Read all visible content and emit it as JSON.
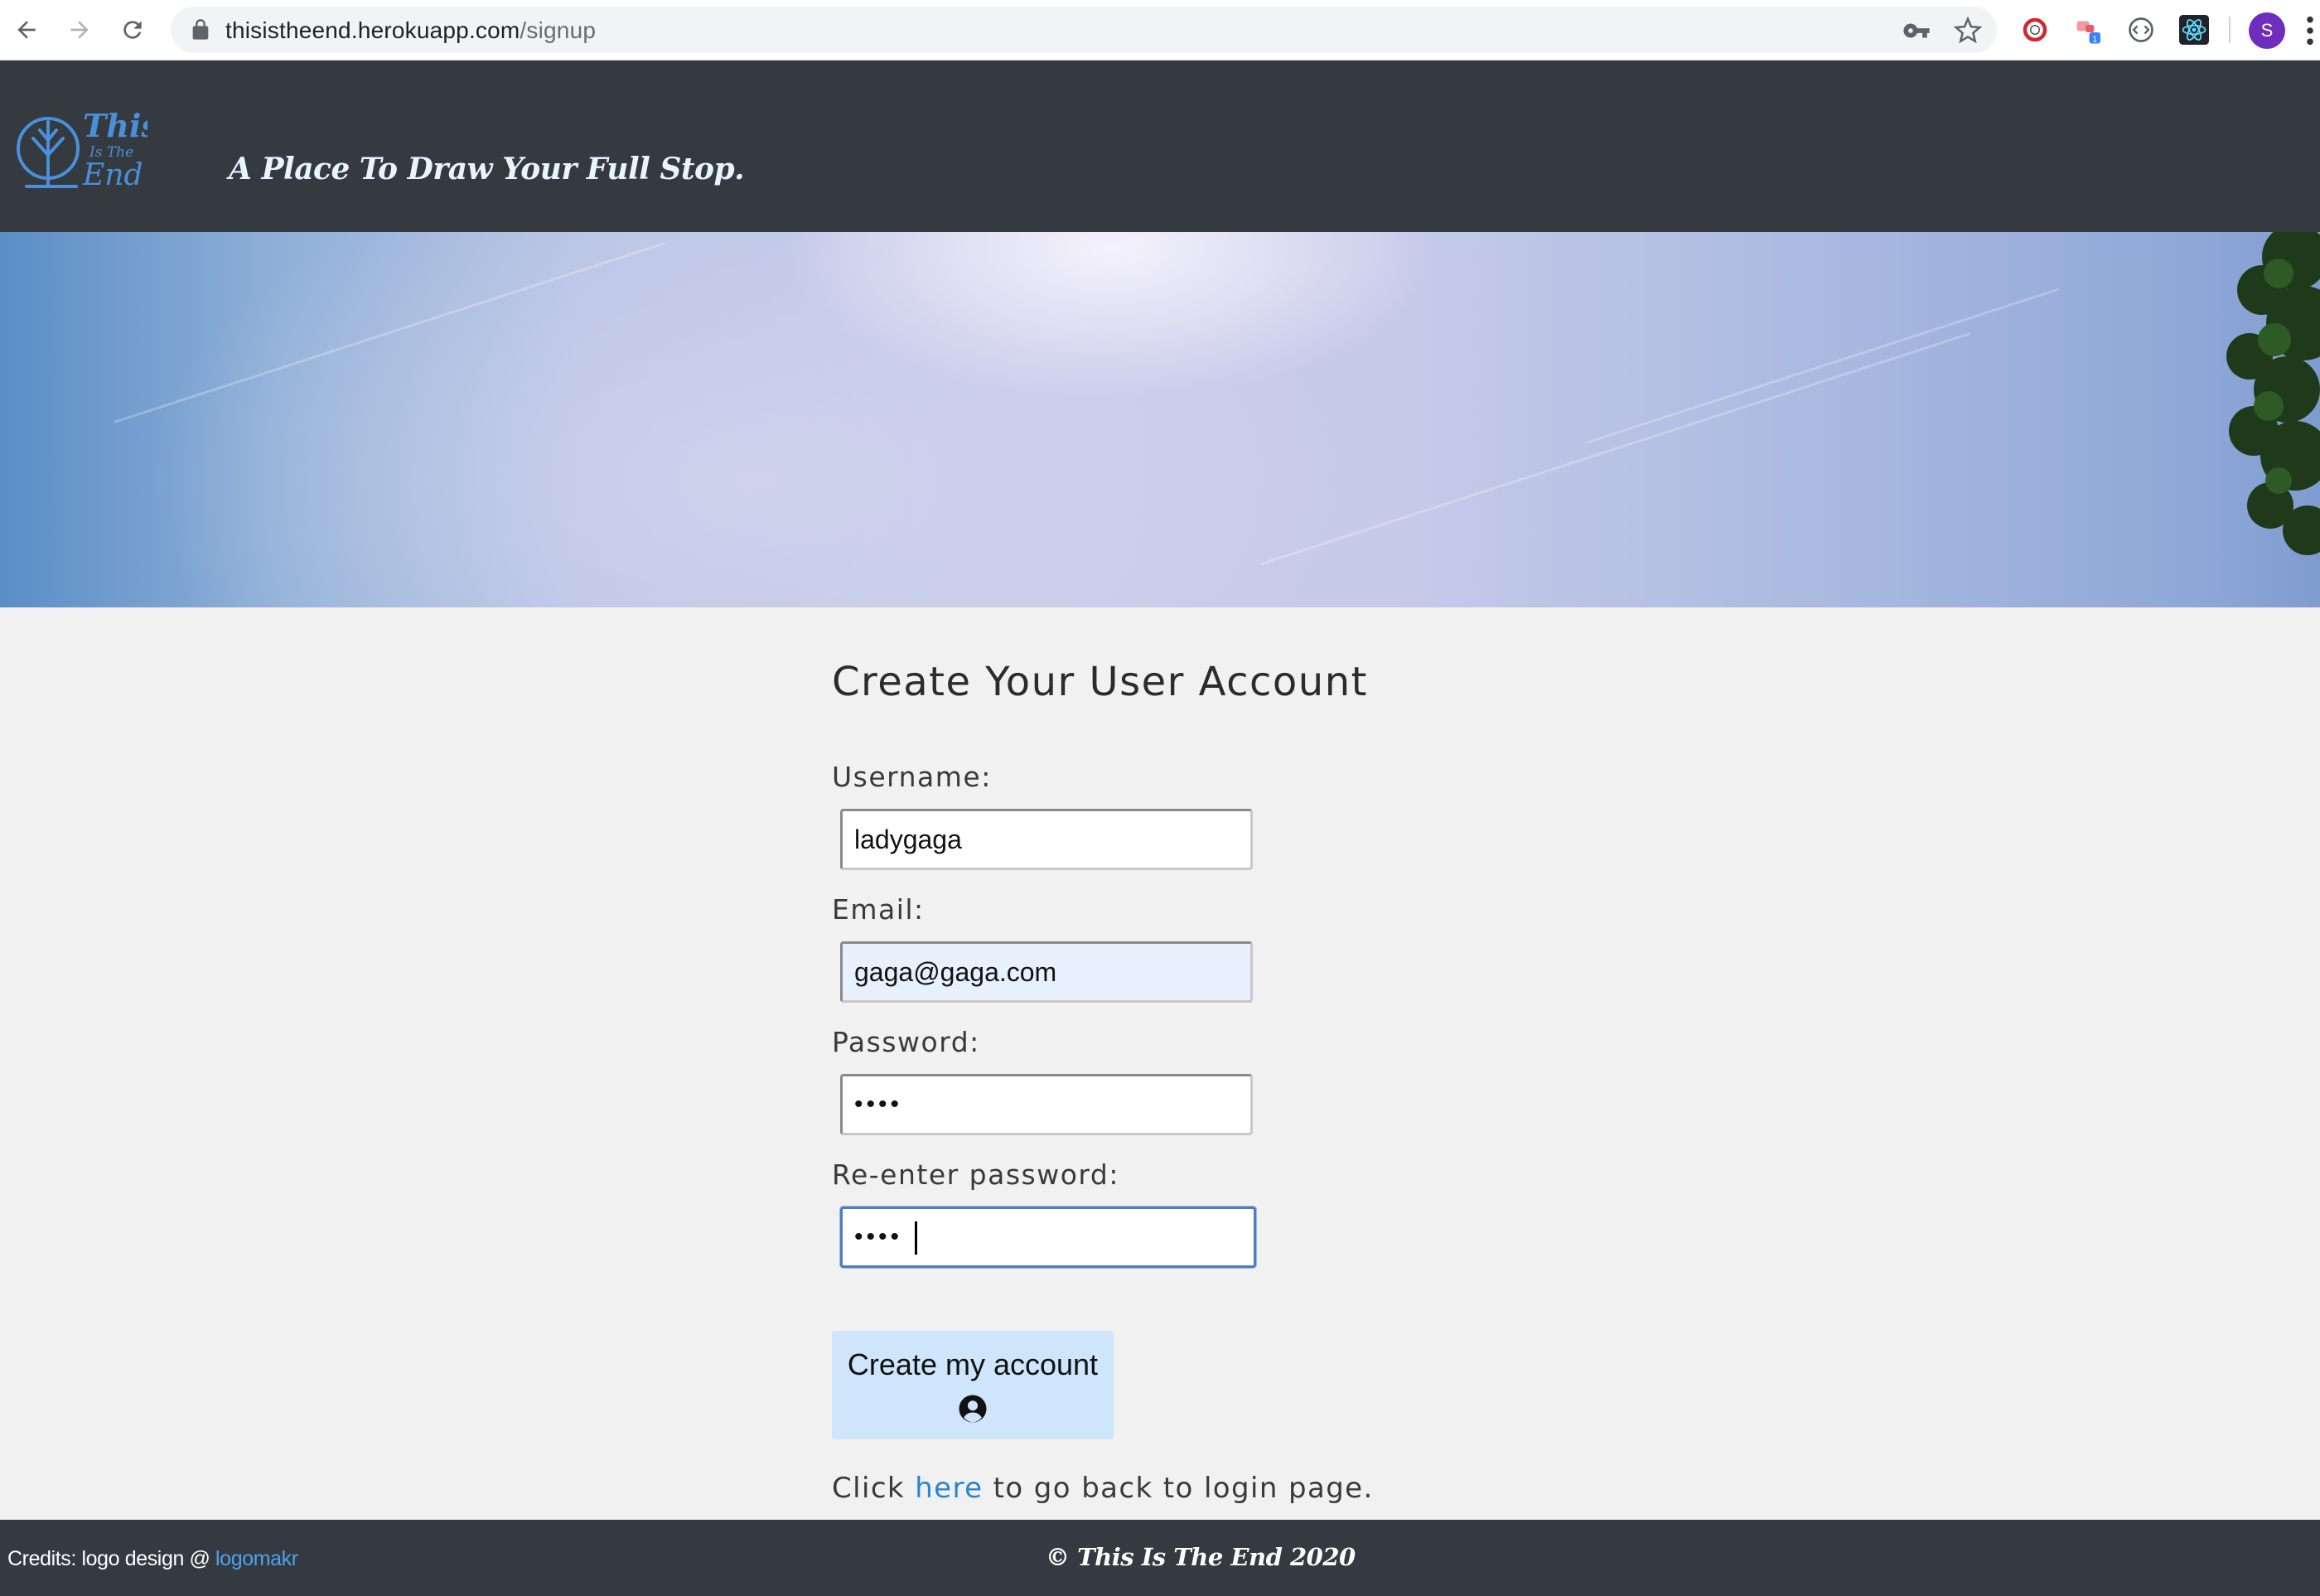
{
  "browser": {
    "url_host": "thisistheend.herokuapp.com",
    "url_path": "/signup",
    "extension_badge": "1",
    "profile_initial": "S"
  },
  "header": {
    "logo_text_line1": "This",
    "logo_text_line2": "Is The",
    "logo_text_line3": "End",
    "tagline": "A Place To Draw Your Full Stop."
  },
  "form": {
    "title": "Create Your User Account",
    "username_label": "Username:",
    "username_value": "ladygaga",
    "email_label": "Email:",
    "email_value": "gaga@gaga.com",
    "password_label": "Password:",
    "password_value": "gaga",
    "password_confirm_label": "Re-enter password:",
    "password_confirm_value": "gaga",
    "submit_label": "Create my account",
    "back_prefix": "Click ",
    "back_link": "here",
    "back_suffix": " to go back to login page."
  },
  "footer": {
    "credits_prefix": "Credits: logo design @ ",
    "credits_link": "logomakr",
    "copyright": "© This Is The End 2020"
  },
  "colors": {
    "header_bg": "#343a40",
    "page_bg": "#f1f1f1",
    "button_bg": "#cfe5fb",
    "link": "#2b83d3",
    "logo": "#4a90d9"
  }
}
